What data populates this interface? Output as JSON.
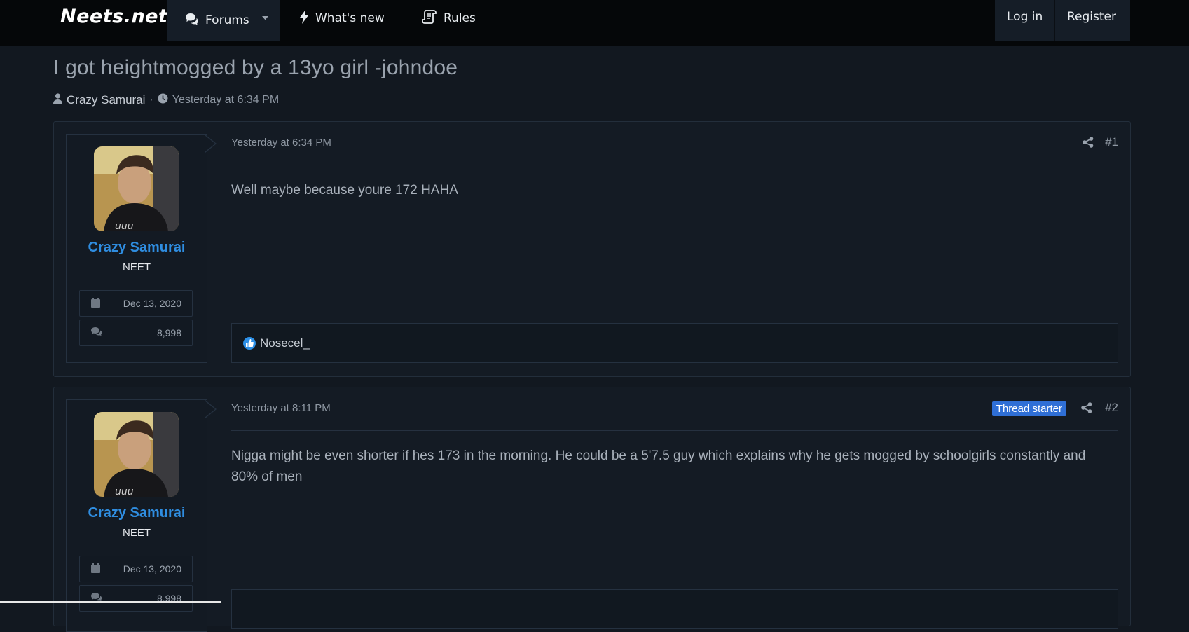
{
  "header": {
    "logo": "Neets.net",
    "nav": {
      "forums": "Forums",
      "whats_new": "What's new",
      "rules": "Rules"
    },
    "auth": {
      "login": "Log in",
      "register": "Register"
    }
  },
  "thread": {
    "title": "I got heightmogged by a 13yo girl -johndoe",
    "author": "Crazy Samurai",
    "separator": "·",
    "started": "Yesterday at 6:34 PM"
  },
  "posts": [
    {
      "date": "Yesterday at 6:34 PM",
      "number": "#1",
      "user": {
        "name": "Crazy Samurai",
        "title": "NEET",
        "joined": "Dec 13, 2020",
        "messages": "8,998"
      },
      "body": "Well maybe because youre 172 HAHA",
      "reactions": "Nosecel_"
    },
    {
      "date": "Yesterday at 8:11 PM",
      "number": "#2",
      "badge": "Thread starter",
      "user": {
        "name": "Crazy Samurai",
        "title": "NEET",
        "joined": "Dec 13, 2020",
        "messages": "8,998"
      },
      "body": "Nigga might be even shorter if hes 173 in the morning. He could be a 5'7.5 guy which explains why he gets mogged by schoolgirls constantly and 80% of men"
    }
  ],
  "colors": {
    "background": "#121820",
    "topbar": "#050709",
    "username": "#2f8de0",
    "badge": "#2f6fd6",
    "like": "#2c8fe6"
  },
  "icons": [
    "comments-icon",
    "caret-down-icon",
    "bolt-icon",
    "scroll-icon",
    "user-icon",
    "clock-icon",
    "calendar-icon",
    "share-icon",
    "thumbs-up-icon"
  ]
}
